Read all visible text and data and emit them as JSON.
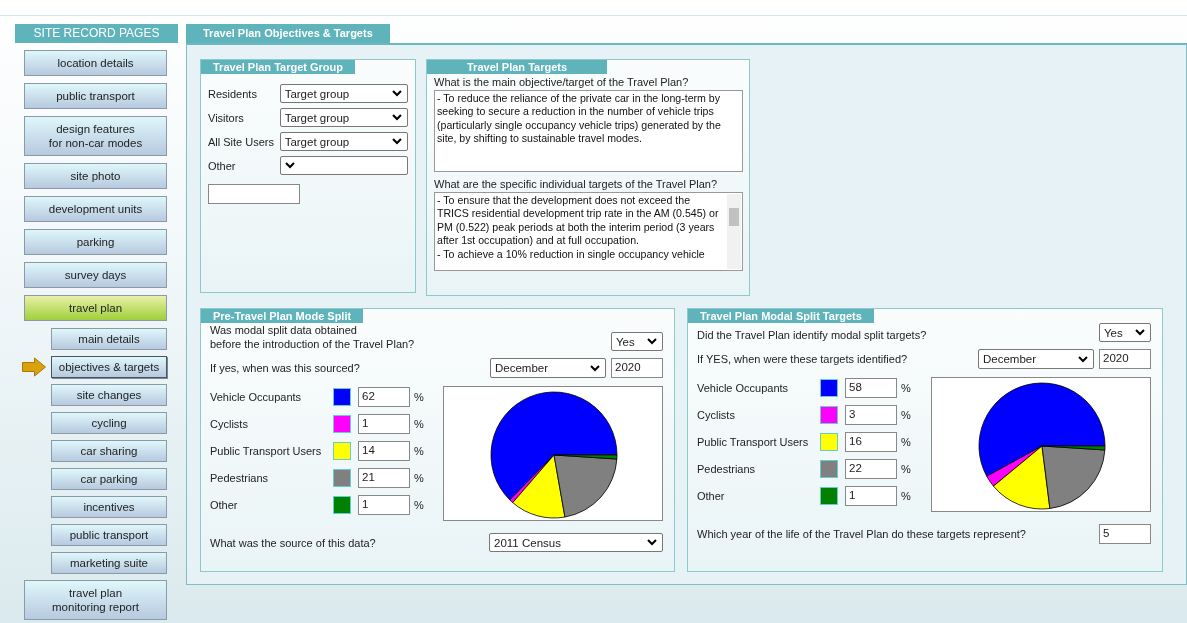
{
  "sidebar": {
    "title": "SITE RECORD PAGES",
    "items": [
      {
        "label": "location details",
        "expanded": false
      },
      {
        "label": "public transport",
        "expanded": false
      },
      {
        "label": "design features\nfor non-car modes",
        "expanded": false
      },
      {
        "label": "site photo",
        "expanded": false
      },
      {
        "label": "development units",
        "expanded": false
      },
      {
        "label": "parking",
        "expanded": false
      },
      {
        "label": "survey days",
        "expanded": false
      },
      {
        "label": "travel plan",
        "expanded": true,
        "children": [
          {
            "label": "main details",
            "selected": false
          },
          {
            "label": "objectives & targets",
            "selected": true
          },
          {
            "label": "site changes",
            "selected": false
          },
          {
            "label": "cycling",
            "selected": false
          },
          {
            "label": "car sharing",
            "selected": false
          },
          {
            "label": "car parking",
            "selected": false
          },
          {
            "label": "incentives",
            "selected": false
          },
          {
            "label": "public transport",
            "selected": false
          },
          {
            "label": "marketing suite",
            "selected": false
          }
        ]
      },
      {
        "label": "travel plan\nmonitoring report",
        "expanded": false
      }
    ]
  },
  "page": {
    "title": "Travel Plan Objectives & Targets"
  },
  "target_group": {
    "title": "Travel Plan Target Group",
    "rows": [
      {
        "label": "Residents",
        "value": "Target group"
      },
      {
        "label": "Visitors",
        "value": "Target group"
      },
      {
        "label": "All Site Users",
        "value": "Target group"
      },
      {
        "label": "Other"
      }
    ]
  },
  "targets": {
    "title": "Travel Plan Targets",
    "questions": [
      {
        "label": "What is the main objective/target of the Travel Plan?",
        "value": "- To reduce the reliance of the private car in the long-term by seeking to secure a reduction in the number of vehicle trips (particularly single occupancy vehicle trips) generated by the site, by shifting to sustainable travel modes.",
        "scrollable": false
      },
      {
        "label": "What are the specific individual targets of the Travel Plan?",
        "value": "- To ensure that the development does not exceed the TRICS residential development trip rate in the AM (0.545) or PM (0.522) peak periods at both the interim period (3 years after 1st occupation) and at full occupation.\n- To achieve a 10% reduction in single occupancy vehicle",
        "scrollable": true
      }
    ]
  },
  "splits": [
    {
      "title": "Pre-Travel Plan Mode Split",
      "question": "Was modal split data obtained\nbefore the introduction of the Travel Plan?",
      "answer": "Yes",
      "when_label": "If yes, when was this sourced?",
      "month": "December",
      "year": "2020",
      "modes": [
        {
          "label": "Vehicle Occupants",
          "color": "#0000ff",
          "value": "62",
          "unit": "%"
        },
        {
          "label": "Cyclists",
          "color": "#ff00ff",
          "value": "1",
          "unit": "%"
        },
        {
          "label": "Public Transport Users",
          "color": "#ffff00",
          "value": "14",
          "unit": "%"
        },
        {
          "label": "Pedestrians",
          "color": "#808080",
          "value": "21",
          "unit": "%"
        },
        {
          "label": "Other",
          "color": "#008000",
          "value": "1",
          "unit": "%"
        }
      ],
      "footer": {
        "kind": "select",
        "label": "What was the source of this data?",
        "value": "2011 Census"
      }
    },
    {
      "title": "Travel Plan Modal Split Targets",
      "question": "Did the Travel Plan identify modal split targets?",
      "answer": "Yes",
      "when_label": "If YES, when were these targets identified?",
      "month": "December",
      "year": "2020",
      "modes": [
        {
          "label": "Vehicle Occupants",
          "color": "#0000ff",
          "value": "58",
          "unit": "%"
        },
        {
          "label": "Cyclists",
          "color": "#ff00ff",
          "value": "3",
          "unit": "%"
        },
        {
          "label": "Public Transport Users",
          "color": "#ffff00",
          "value": "16",
          "unit": "%"
        },
        {
          "label": "Pedestrians",
          "color": "#808080",
          "value": "22",
          "unit": "%"
        },
        {
          "label": "Other",
          "color": "#008000",
          "value": "1",
          "unit": "%"
        }
      ],
      "footer": {
        "kind": "input",
        "label": "Which year of the life of the Travel Plan do these targets represent?",
        "value": "5"
      }
    }
  ]
}
